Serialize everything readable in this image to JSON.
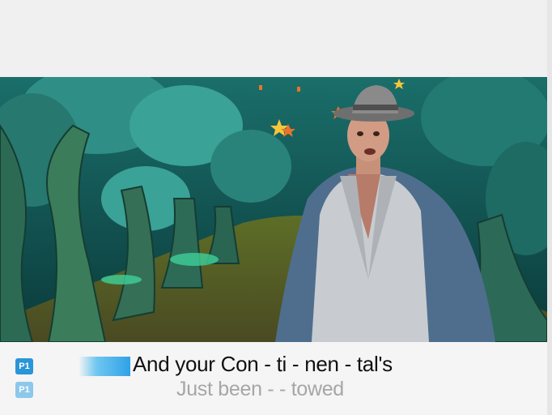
{
  "lyrics": {
    "current_line": "And your Con - ti - nen - tal's",
    "next_line": "Just been - - towed",
    "player_badge_current": "P1",
    "player_badge_next": "P1",
    "progress_fraction": 1.0
  },
  "colors": {
    "badge_active": "#2a95d8",
    "badge_inactive": "#8cc8ec",
    "progress_bar": "#2fa2e7",
    "current_text": "#111111",
    "next_text": "#a6a6a6"
  },
  "video": {
    "scene": "music-video-forest-with-singer"
  }
}
